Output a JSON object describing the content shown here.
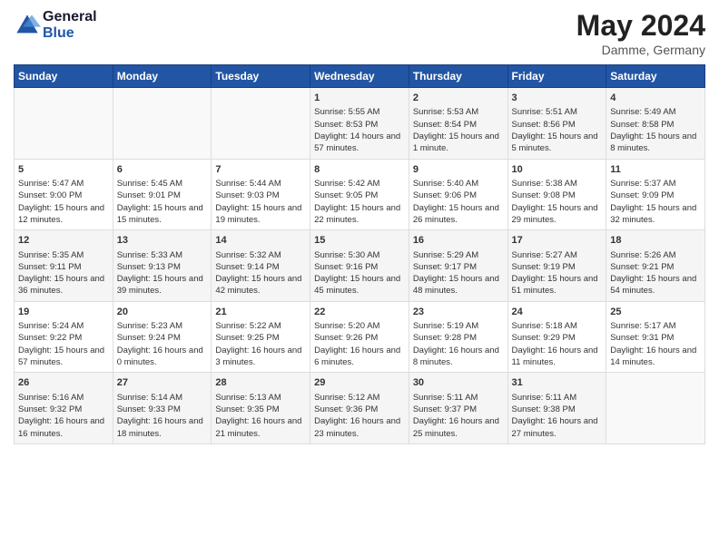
{
  "header": {
    "logo_line1": "General",
    "logo_line2": "Blue",
    "month_year": "May 2024",
    "location": "Damme, Germany"
  },
  "days_of_week": [
    "Sunday",
    "Monday",
    "Tuesday",
    "Wednesday",
    "Thursday",
    "Friday",
    "Saturday"
  ],
  "weeks": [
    [
      {
        "day": "",
        "sunrise": "",
        "sunset": "",
        "daylight": ""
      },
      {
        "day": "",
        "sunrise": "",
        "sunset": "",
        "daylight": ""
      },
      {
        "day": "",
        "sunrise": "",
        "sunset": "",
        "daylight": ""
      },
      {
        "day": "1",
        "sunrise": "Sunrise: 5:55 AM",
        "sunset": "Sunset: 8:53 PM",
        "daylight": "Daylight: 14 hours and 57 minutes."
      },
      {
        "day": "2",
        "sunrise": "Sunrise: 5:53 AM",
        "sunset": "Sunset: 8:54 PM",
        "daylight": "Daylight: 15 hours and 1 minute."
      },
      {
        "day": "3",
        "sunrise": "Sunrise: 5:51 AM",
        "sunset": "Sunset: 8:56 PM",
        "daylight": "Daylight: 15 hours and 5 minutes."
      },
      {
        "day": "4",
        "sunrise": "Sunrise: 5:49 AM",
        "sunset": "Sunset: 8:58 PM",
        "daylight": "Daylight: 15 hours and 8 minutes."
      }
    ],
    [
      {
        "day": "5",
        "sunrise": "Sunrise: 5:47 AM",
        "sunset": "Sunset: 9:00 PM",
        "daylight": "Daylight: 15 hours and 12 minutes."
      },
      {
        "day": "6",
        "sunrise": "Sunrise: 5:45 AM",
        "sunset": "Sunset: 9:01 PM",
        "daylight": "Daylight: 15 hours and 15 minutes."
      },
      {
        "day": "7",
        "sunrise": "Sunrise: 5:44 AM",
        "sunset": "Sunset: 9:03 PM",
        "daylight": "Daylight: 15 hours and 19 minutes."
      },
      {
        "day": "8",
        "sunrise": "Sunrise: 5:42 AM",
        "sunset": "Sunset: 9:05 PM",
        "daylight": "Daylight: 15 hours and 22 minutes."
      },
      {
        "day": "9",
        "sunrise": "Sunrise: 5:40 AM",
        "sunset": "Sunset: 9:06 PM",
        "daylight": "Daylight: 15 hours and 26 minutes."
      },
      {
        "day": "10",
        "sunrise": "Sunrise: 5:38 AM",
        "sunset": "Sunset: 9:08 PM",
        "daylight": "Daylight: 15 hours and 29 minutes."
      },
      {
        "day": "11",
        "sunrise": "Sunrise: 5:37 AM",
        "sunset": "Sunset: 9:09 PM",
        "daylight": "Daylight: 15 hours and 32 minutes."
      }
    ],
    [
      {
        "day": "12",
        "sunrise": "Sunrise: 5:35 AM",
        "sunset": "Sunset: 9:11 PM",
        "daylight": "Daylight: 15 hours and 36 minutes."
      },
      {
        "day": "13",
        "sunrise": "Sunrise: 5:33 AM",
        "sunset": "Sunset: 9:13 PM",
        "daylight": "Daylight: 15 hours and 39 minutes."
      },
      {
        "day": "14",
        "sunrise": "Sunrise: 5:32 AM",
        "sunset": "Sunset: 9:14 PM",
        "daylight": "Daylight: 15 hours and 42 minutes."
      },
      {
        "day": "15",
        "sunrise": "Sunrise: 5:30 AM",
        "sunset": "Sunset: 9:16 PM",
        "daylight": "Daylight: 15 hours and 45 minutes."
      },
      {
        "day": "16",
        "sunrise": "Sunrise: 5:29 AM",
        "sunset": "Sunset: 9:17 PM",
        "daylight": "Daylight: 15 hours and 48 minutes."
      },
      {
        "day": "17",
        "sunrise": "Sunrise: 5:27 AM",
        "sunset": "Sunset: 9:19 PM",
        "daylight": "Daylight: 15 hours and 51 minutes."
      },
      {
        "day": "18",
        "sunrise": "Sunrise: 5:26 AM",
        "sunset": "Sunset: 9:21 PM",
        "daylight": "Daylight: 15 hours and 54 minutes."
      }
    ],
    [
      {
        "day": "19",
        "sunrise": "Sunrise: 5:24 AM",
        "sunset": "Sunset: 9:22 PM",
        "daylight": "Daylight: 15 hours and 57 minutes."
      },
      {
        "day": "20",
        "sunrise": "Sunrise: 5:23 AM",
        "sunset": "Sunset: 9:24 PM",
        "daylight": "Daylight: 16 hours and 0 minutes."
      },
      {
        "day": "21",
        "sunrise": "Sunrise: 5:22 AM",
        "sunset": "Sunset: 9:25 PM",
        "daylight": "Daylight: 16 hours and 3 minutes."
      },
      {
        "day": "22",
        "sunrise": "Sunrise: 5:20 AM",
        "sunset": "Sunset: 9:26 PM",
        "daylight": "Daylight: 16 hours and 6 minutes."
      },
      {
        "day": "23",
        "sunrise": "Sunrise: 5:19 AM",
        "sunset": "Sunset: 9:28 PM",
        "daylight": "Daylight: 16 hours and 8 minutes."
      },
      {
        "day": "24",
        "sunrise": "Sunrise: 5:18 AM",
        "sunset": "Sunset: 9:29 PM",
        "daylight": "Daylight: 16 hours and 11 minutes."
      },
      {
        "day": "25",
        "sunrise": "Sunrise: 5:17 AM",
        "sunset": "Sunset: 9:31 PM",
        "daylight": "Daylight: 16 hours and 14 minutes."
      }
    ],
    [
      {
        "day": "26",
        "sunrise": "Sunrise: 5:16 AM",
        "sunset": "Sunset: 9:32 PM",
        "daylight": "Daylight: 16 hours and 16 minutes."
      },
      {
        "day": "27",
        "sunrise": "Sunrise: 5:14 AM",
        "sunset": "Sunset: 9:33 PM",
        "daylight": "Daylight: 16 hours and 18 minutes."
      },
      {
        "day": "28",
        "sunrise": "Sunrise: 5:13 AM",
        "sunset": "Sunset: 9:35 PM",
        "daylight": "Daylight: 16 hours and 21 minutes."
      },
      {
        "day": "29",
        "sunrise": "Sunrise: 5:12 AM",
        "sunset": "Sunset: 9:36 PM",
        "daylight": "Daylight: 16 hours and 23 minutes."
      },
      {
        "day": "30",
        "sunrise": "Sunrise: 5:11 AM",
        "sunset": "Sunset: 9:37 PM",
        "daylight": "Daylight: 16 hours and 25 minutes."
      },
      {
        "day": "31",
        "sunrise": "Sunrise: 5:11 AM",
        "sunset": "Sunset: 9:38 PM",
        "daylight": "Daylight: 16 hours and 27 minutes."
      },
      {
        "day": "",
        "sunrise": "",
        "sunset": "",
        "daylight": ""
      }
    ]
  ]
}
